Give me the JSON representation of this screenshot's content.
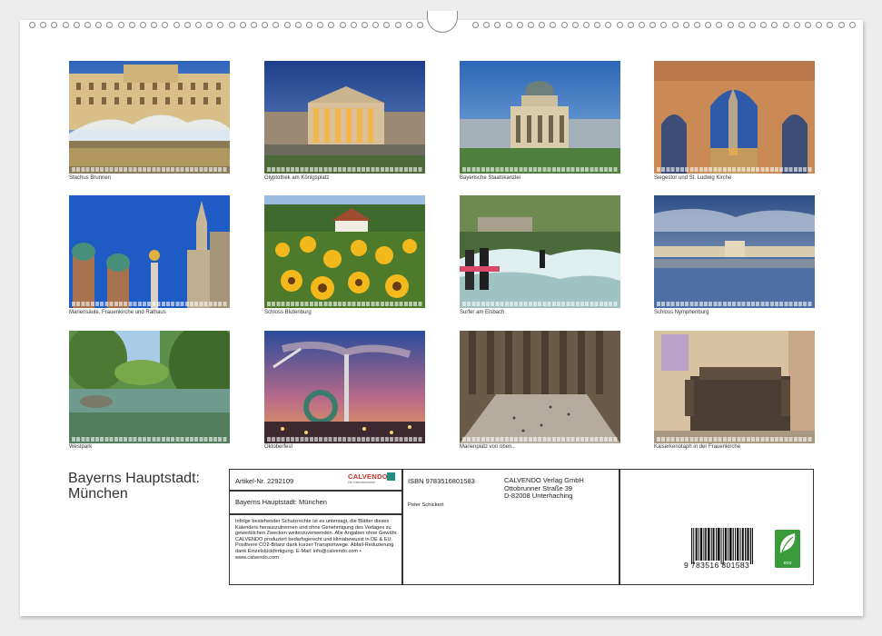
{
  "calendar": {
    "title_line1": "Bayerns Hauptstadt:",
    "title_line2": "München"
  },
  "photos": [
    {
      "caption": "Stachus Brunnen",
      "icon": "fountain-palace"
    },
    {
      "caption": "Glyptothek am Königsplatz",
      "icon": "temple-museum"
    },
    {
      "caption": "Bayerische Staatskanzlei",
      "icon": "domed-building"
    },
    {
      "caption": "Siegestor und St. Ludwig Kirche",
      "icon": "triumphal-arch"
    },
    {
      "caption": "Mariensäule, Frauenkirche und Rathaus",
      "icon": "church-towers"
    },
    {
      "caption": "Schloss Blutenburg",
      "icon": "sunflower-field"
    },
    {
      "caption": "Surfer am Eisbach",
      "icon": "river-surfers"
    },
    {
      "caption": "Schloss Nymphenburg",
      "icon": "palace-reflection"
    },
    {
      "caption": "Westpark",
      "icon": "park-pond"
    },
    {
      "caption": "Oktoberfest",
      "icon": "fairground-rides"
    },
    {
      "caption": "Marienplatz von oben..",
      "icon": "square-aerial"
    },
    {
      "caption": "Kaiserkenotaph in der Frauenkirche",
      "icon": "cenotaph-statue"
    }
  ],
  "info": {
    "article": "Artikel-Nr. 2292109",
    "brand": "CALVENDO",
    "brand_sub": "Die Kalendermarke",
    "product_title": "Bayerns Hauptstadt: München",
    "legal_text": "Infolge bestehender Schutzrechte ist es untersagt, die Blätter dieses Kalenders herauszutrennen und ohne Genehmigung des Verlages zu gewerblichen Zwecken weiterzuverwenden. Alle Angaben ohne Gewähr. CALVENDO produziert bedarfsgerecht und klimabewusst in DE & EU. Positivere CO2-Bilanz dank kurzer Transportwege. Abfall-Reduzierung dank Einzelstückfertigung. E-Mail: info@calvendo.com • www.calvendo.com",
    "isbn": "ISBN 9783516801583",
    "author": "Peter Schickert",
    "publisher_line1": "CALVENDO Verlag GmbH",
    "publisher_line2": "Ottobrunner Straße 39",
    "publisher_line3": "D-82008 Unterhaching",
    "barcode_number": "9  783516  801583",
    "eco_label": "eco"
  }
}
